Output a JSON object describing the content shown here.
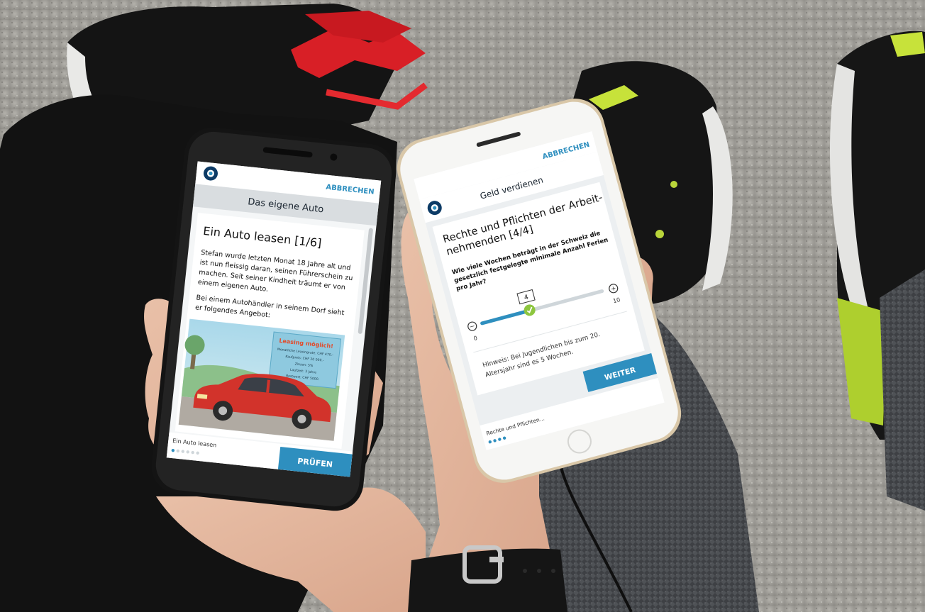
{
  "phone_left": {
    "cancel_label": "ABBRECHEN",
    "header_title": "Das eigene Auto",
    "lesson_title": "Ein Auto leasen [1/6]",
    "paragraph_1": [
      "Stefan wurde letzten Monat 18 Jahre alt und",
      "ist nun fleissig daran, seinen Führerschein zu",
      "machen. Seit seiner Kindheit träumt er von",
      "einem eigenen Auto."
    ],
    "paragraph_2": [
      "Bei einem Autohändler in seinem Dorf sieht",
      "er folgendes Angebot:"
    ],
    "ad": {
      "headline": "Leasing möglich!",
      "lines": [
        "Monatliche Leasingrate: CHF 470.-",
        "Kaufpreis: CHF 20 000.-",
        "Zinsen: 5%",
        "Laufzeit: 3 Jahre",
        "Restwert: CHF 5000."
      ]
    },
    "footer_label": "Ein Auto leasen",
    "submit_label": "PRÜFEN",
    "progress_current": 1,
    "progress_total": 6
  },
  "phone_right": {
    "cancel_label": "ABBRECHEN",
    "header_title": "Geld verdienen",
    "lesson_title": [
      "Rechte und Pflichten der Arbeit-",
      "nehmenden [4/4]"
    ],
    "question": [
      "Wie viele Wochen beträgt in der Schweiz die",
      "gesetzlich festgelegte minimale Anzahl Ferien",
      "pro Jahr?"
    ],
    "slider": {
      "value_label": "4",
      "min_label": "0",
      "max_label": "10",
      "value": 4,
      "min": 0,
      "max": 10
    },
    "hint": [
      "Hinweis: Bei Jugendlichen bis zum 20.",
      "Altersjahr sind es 5 Wochen."
    ],
    "footer_label": "Rechte und Pflichten...",
    "next_label": "WEITER",
    "progress_current": 4,
    "progress_total": 4
  },
  "colors": {
    "accent": "#2e8fbf",
    "brand_dark": "#0d3b66",
    "slider_ok": "#8dc63f"
  }
}
